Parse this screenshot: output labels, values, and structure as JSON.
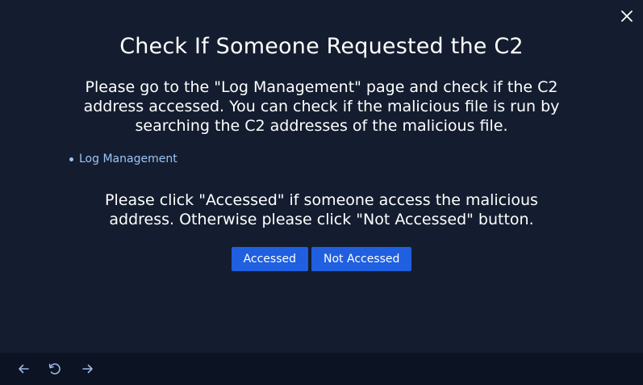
{
  "dialog": {
    "title": "Check If Someone Requested the C2",
    "description": "Please go to the \"Log Management\" page and check if the C2 address accessed. You can check if the malicious file is run by searching the C2 addresses of the malicious file.",
    "links": [
      {
        "label": "Log Management"
      }
    ],
    "instruction": "Please click \"Accessed\" if someone access the malicious address. Otherwise please click \"Not Accessed\" button.",
    "buttons": {
      "accessed": "Accessed",
      "not_accessed": "Not Accessed"
    },
    "close_icon": "close-icon"
  },
  "footer": {
    "icons": [
      "arrow-left-icon",
      "refresh-icon",
      "arrow-right-icon"
    ]
  },
  "colors": {
    "background": "#141d2f",
    "footer": "#0c1322",
    "primary_button": "#1f5fe0",
    "link": "#9bc4f5",
    "text": "#ffffff"
  }
}
